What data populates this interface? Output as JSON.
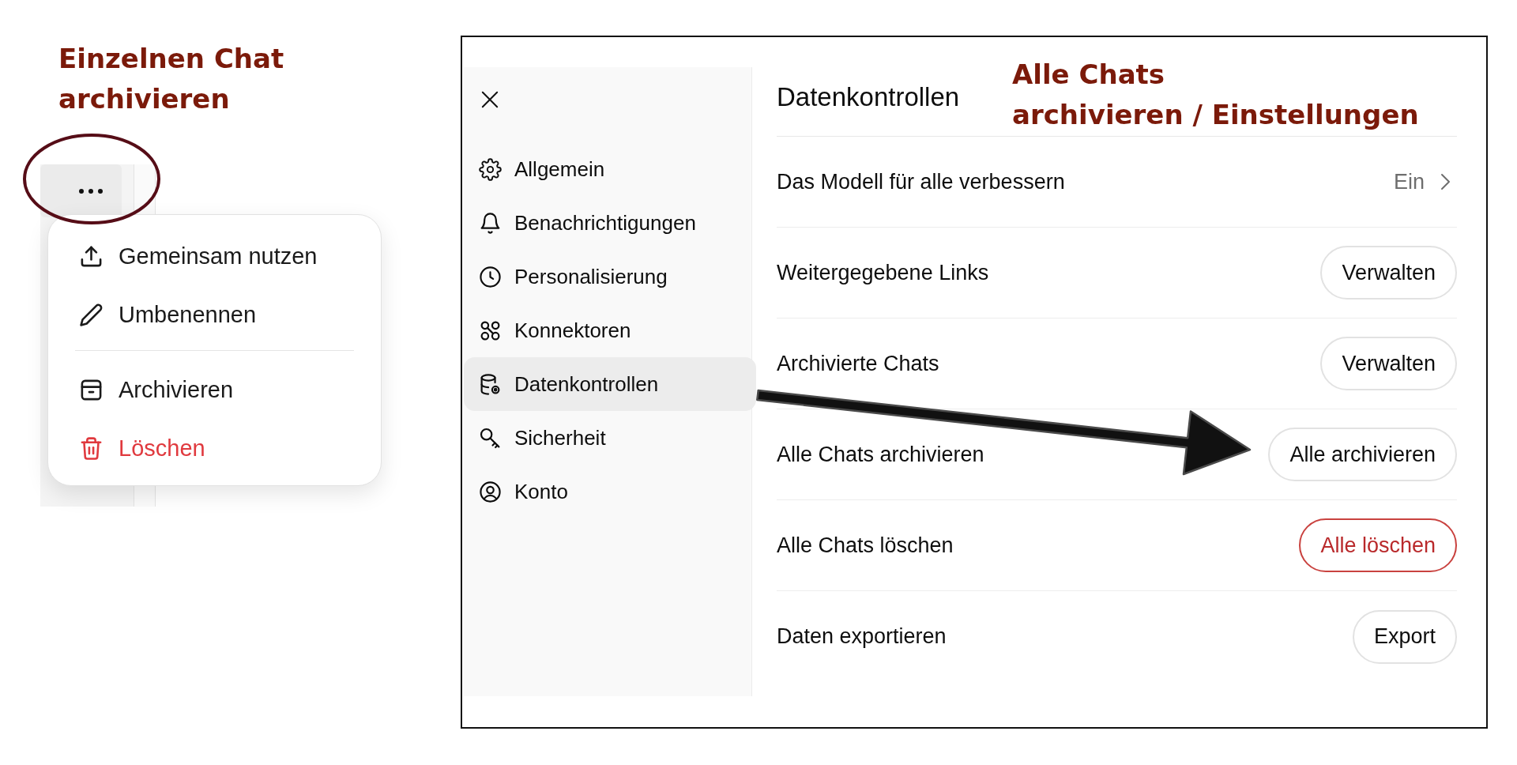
{
  "chat_menu": {
    "annotation": "Einzelnen Chat\narchivieren",
    "menu": {
      "groups": [
        {
          "items": [
            {
              "label": "Gemeinsam nutzen",
              "danger": false
            },
            {
              "label": "Umbenennen",
              "danger": false
            }
          ]
        },
        {
          "items": [
            {
              "label": "Archivieren",
              "danger": false
            },
            {
              "label": "Löschen",
              "danger": true
            }
          ]
        }
      ]
    }
  },
  "settings": {
    "annotation": "Alle Chats\narchivieren / Einstellungen",
    "sidebar": {
      "items": [
        {
          "label": "Allgemein",
          "selected": false
        },
        {
          "label": "Benachrichtigungen",
          "selected": false
        },
        {
          "label": "Personalisierung",
          "selected": false
        },
        {
          "label": "Konnektoren",
          "selected": false
        },
        {
          "label": "Datenkontrollen",
          "selected": true
        },
        {
          "label": "Sicherheit",
          "selected": false
        },
        {
          "label": "Konto",
          "selected": false
        }
      ]
    },
    "title": "Datenkontrollen",
    "rows": [
      {
        "label": "Das Modell für alle verbessern",
        "action": {
          "kind": "value",
          "text": "Ein"
        }
      },
      {
        "label": "Weitergegebene Links",
        "action": {
          "kind": "button",
          "text": "Verwalten",
          "danger": false
        }
      },
      {
        "label": "Archivierte Chats",
        "action": {
          "kind": "button",
          "text": "Verwalten",
          "danger": false
        }
      },
      {
        "label": "Alle Chats archivieren",
        "action": {
          "kind": "button",
          "text": "Alle archivieren",
          "danger": false
        }
      },
      {
        "label": "Alle Chats löschen",
        "action": {
          "kind": "button",
          "text": "Alle löschen",
          "danger": true
        }
      },
      {
        "label": "Daten exportieren",
        "action": {
          "kind": "button",
          "text": "Export",
          "danger": false
        }
      }
    ]
  }
}
